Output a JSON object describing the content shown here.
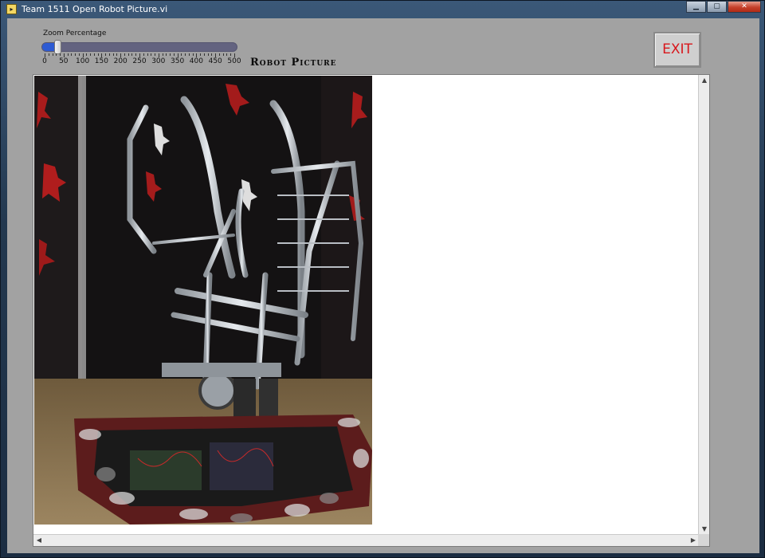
{
  "window": {
    "title": "Team 1511 Open Robot Picture.vi",
    "icon": "labview-vi-icon",
    "controls": {
      "minimize": "minimize-icon",
      "maximize": "maximize-icon",
      "close": "close-icon"
    }
  },
  "zoom": {
    "label": "Zoom Percentage",
    "value": 25,
    "min": 0,
    "max": 500,
    "scale": [
      "0",
      "50",
      "100",
      "150",
      "200",
      "250",
      "300",
      "350",
      "400",
      "450",
      "500"
    ],
    "fill_color": "#2d5bd3",
    "track_color": "#636380"
  },
  "heading": "Robot Picture",
  "exit_button": {
    "label": "EXIT",
    "color": "#d8161b"
  },
  "viewer": {
    "image": "robot-photo"
  }
}
